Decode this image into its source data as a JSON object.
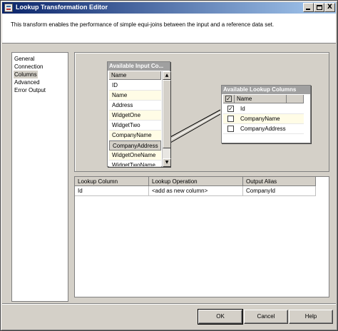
{
  "window": {
    "title": "Lookup Transformation Editor",
    "description": "This transform enables the performance of simple equi-joins between the input and a reference data set."
  },
  "title_buttons": {
    "minimize": "_",
    "maximize": "□",
    "close": "X"
  },
  "nav": {
    "items": [
      {
        "label": "General",
        "selected": false
      },
      {
        "label": "Connection",
        "selected": false
      },
      {
        "label": "Columns",
        "selected": true
      },
      {
        "label": "Advanced",
        "selected": false
      },
      {
        "label": "Error Output",
        "selected": false
      }
    ]
  },
  "input_columns": {
    "title": "Available Input Co...",
    "header": "Name",
    "rows": [
      "ID",
      "Name",
      "Address",
      "WidgetOne",
      "WidgetTwo",
      "CompanyName",
      "CompanyAddress",
      "WidgetOneName",
      "WidgetTwoName"
    ],
    "selected_index": 6
  },
  "lookup_columns": {
    "title": "Available Lookup Columns",
    "header": "Name",
    "rows": [
      {
        "label": "Id",
        "checked": true
      },
      {
        "label": "CompanyName",
        "checked": false
      },
      {
        "label": "CompanyAddress",
        "checked": false
      }
    ]
  },
  "output_grid": {
    "headers": [
      "Lookup Column",
      "Lookup Operation",
      "Output Alias"
    ],
    "rows": [
      [
        "Id",
        "<add as new column>",
        "CompanyId"
      ]
    ]
  },
  "buttons": {
    "ok": "OK",
    "cancel": "Cancel",
    "help": "Help"
  },
  "glyphs": {
    "check": "✓",
    "scroll_up": "▲",
    "scroll_down": "▼"
  }
}
